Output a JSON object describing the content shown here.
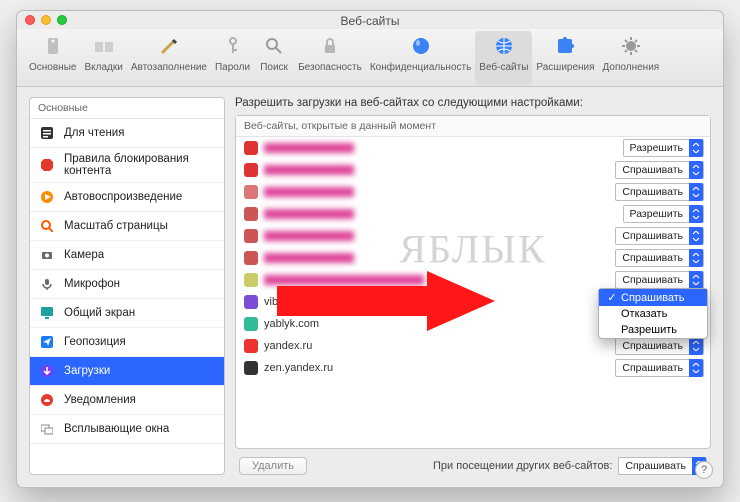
{
  "window": {
    "title": "Веб-сайты"
  },
  "toolbar": {
    "items": [
      {
        "id": "general",
        "label": "Основные"
      },
      {
        "id": "tabs",
        "label": "Вкладки"
      },
      {
        "id": "autofill",
        "label": "Автозаполнение"
      },
      {
        "id": "passwords",
        "label": "Пароли"
      },
      {
        "id": "search",
        "label": "Поиск"
      },
      {
        "id": "security",
        "label": "Безопасность"
      },
      {
        "id": "privacy",
        "label": "Конфиденциальность"
      },
      {
        "id": "websites",
        "label": "Веб-сайты",
        "selected": true
      },
      {
        "id": "extensions",
        "label": "Расширения"
      },
      {
        "id": "advanced",
        "label": "Дополнения"
      }
    ]
  },
  "sidebar": {
    "header": "Основные",
    "items": [
      {
        "icon": "reader",
        "color": "#333",
        "label": "Для чтения"
      },
      {
        "icon": "block",
        "color": "#e23b2e",
        "label": "Правила блокирования контента"
      },
      {
        "icon": "autoplay",
        "color": "#ff8a00",
        "label": "Автовоспроизведение"
      },
      {
        "icon": "zoom",
        "color": "#ff5a00",
        "label": "Масштаб страницы"
      },
      {
        "icon": "camera",
        "color": "#6b6b6b",
        "label": "Камера"
      },
      {
        "icon": "mic",
        "color": "#6b6b6b",
        "label": "Микрофон"
      },
      {
        "icon": "screen",
        "color": "#1da0a0",
        "label": "Общий экран"
      },
      {
        "icon": "location",
        "color": "#1a7df0",
        "label": "Геопозиция"
      },
      {
        "icon": "downloads",
        "color": "#7a3cf0",
        "label": "Загрузки",
        "active": true
      },
      {
        "icon": "notify",
        "color": "#e23b2e",
        "label": "Уведомления"
      },
      {
        "icon": "popups",
        "color": "#888",
        "label": "Всплывающие окна"
      }
    ]
  },
  "main": {
    "heading": "Разрешить загрузки на веб-сайтах со следующими настройками:",
    "list_header": "Веб-сайты, открытые в данный момент",
    "options": {
      "allow": "Разрешить",
      "ask": "Спрашивать",
      "deny": "Отказать"
    },
    "rows": [
      {
        "host": "hidden",
        "value": "allow",
        "blurred": true,
        "fav": "#d33"
      },
      {
        "host": "hidden",
        "value": "ask",
        "blurred": true,
        "fav": "#d33"
      },
      {
        "host": "hidden",
        "value": "ask",
        "blurred": true,
        "fav": "#d77"
      },
      {
        "host": "hidden",
        "value": "allow",
        "blurred": true,
        "fav": "#c55"
      },
      {
        "host": "hidden",
        "value": "ask",
        "blurred": true,
        "fav": "#c55"
      },
      {
        "host": "hidden",
        "value": "ask",
        "blurred": true,
        "fav": "#c55"
      },
      {
        "host": "hidden",
        "value": "ask",
        "blurred": true,
        "fav": "#cc6",
        "wide": true
      },
      {
        "host": "viber.com",
        "value": "menu",
        "fav": "#7b4dd6"
      },
      {
        "host": "yablyk.com",
        "value": "ask",
        "fav": "#3b9"
      },
      {
        "host": "yandex.ru",
        "value": "ask",
        "fav": "#e33"
      },
      {
        "host": "zen.yandex.ru",
        "value": "ask",
        "fav": "#333"
      }
    ],
    "menu_items": [
      "Спрашивать",
      "Отказать",
      "Разрешить"
    ],
    "delete_label": "Удалить",
    "footer_label": "При посещении других веб-сайтов:",
    "footer_value": "Спрашивать"
  },
  "watermark": "ЯБЛЫК",
  "help": "?"
}
